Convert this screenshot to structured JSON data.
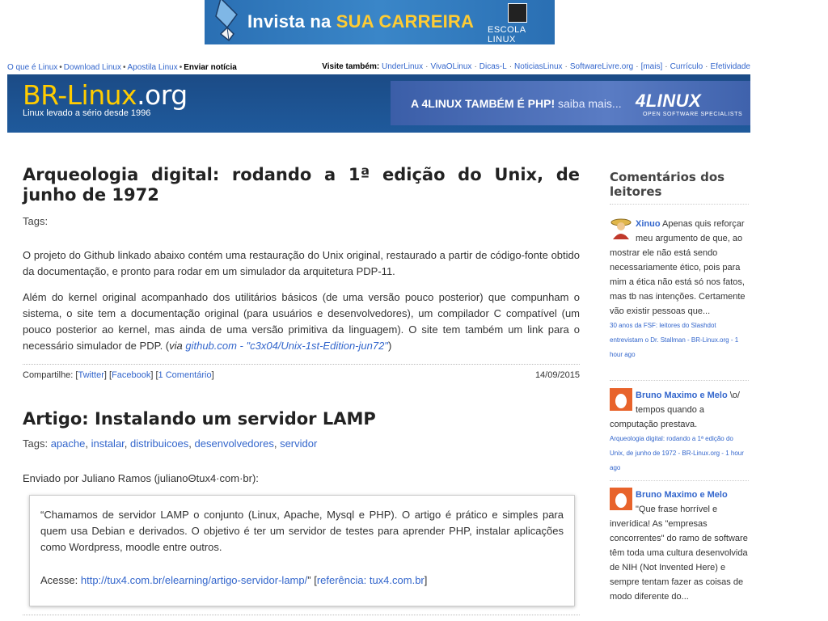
{
  "banner": {
    "text_main": "Invista na",
    "text_highlight": "SUA CARREIRA",
    "logo_label": "ESCOLA LINUX"
  },
  "nav": {
    "items": [
      {
        "label": "O que é Linux"
      },
      {
        "label": "Download Linux"
      },
      {
        "label": "Apostila Linux"
      },
      {
        "label": "Enviar notícia"
      }
    ],
    "visit_label": "Visite também:",
    "visit_links": [
      {
        "label": "UnderLinux"
      },
      {
        "label": "VivaOLinux"
      },
      {
        "label": "Dicas-L"
      },
      {
        "label": "NoticiasLinux"
      },
      {
        "label": "SoftwareLivre.org"
      },
      {
        "label": "[mais]"
      },
      {
        "label": "Currículo"
      },
      {
        "label": "Efetividade"
      }
    ]
  },
  "header": {
    "title_main": "BR-Linux",
    "title_suffix": ".org",
    "tagline": "Linux levado a sério desde 1996",
    "ad_text": "A 4LINUX TAMBÉM É PHP!",
    "ad_more": "saiba mais...",
    "ad_brand": "4LINUX",
    "ad_brand_sub": "OPEN SOFTWARE SPECIALISTS"
  },
  "post1": {
    "title": "Arqueologia digital: rodando a 1ª edição do Unix, de junho de 1972",
    "tags_label": "Tags:",
    "p1": "O projeto do Github linkado abaixo contém uma restauração do Unix original, restaurado a partir de código-fonte obtido da documentação, e pronto para rodar em um simulador da arquitetura PDP-11.",
    "p2": "Além do kernel original acompanhado dos utilitários básicos (de uma versão pouco posterior) que compunham o sistema, o site tem a documentação original (para usuários e desenvolvedores), um compilador C compatível (um pouco posterior ao kernel, mas ainda de uma versão primitiva da linguagem). O site tem também um link para o necessário simulador de PDP. (",
    "via_prefix": "via ",
    "via_link": "github.com - \"c3x04/Unix-1st-Edition-jun72\"",
    "p2_end": ")",
    "share_label": "Compartilhe:",
    "share_twitter": "Twitter",
    "share_facebook": "Facebook",
    "comments": "1 Comentário",
    "date": "14/09/2015"
  },
  "post2": {
    "title": "Artigo: Instalando um servidor LAMP",
    "tags_label": "Tags:",
    "tags": [
      "apache",
      "instalar",
      "distribuicoes",
      "desenvolvedores",
      "servidor"
    ],
    "sent_by": "Enviado por Juliano Ramos (julianoΘtux4·com·br):",
    "quote": "“Chamamos de servidor LAMP o conjunto (Linux, Apache, Mysql e PHP). O artigo é prático e simples para quem usa Debian e derivados. O objetivo é ter um servidor de testes para aprender PHP, instalar aplicações como Wordpress, moodle entre outros.",
    "access_label": "Acesse:",
    "access_link": "http://tux4.com.br/elearning/artigo-servidor-lamp/",
    "access_quote_end": "”",
    "ref_link": "referência: tux4.com.br"
  },
  "sidebar": {
    "title": "Comentários dos leitores",
    "comments": [
      {
        "author": "Xinuo",
        "text": " Apenas quis reforçar meu argumento de que, ao mostrar ele não está sendo necessariamente ético, pois para mim a ética não está só nos fatos, mas tb nas intenções. Certamente vão existir pessoas que...",
        "source": "30 anos da FSF: leitores do Slashdot entrevistam o Dr. Stallman - BR-Linux.org - 1 hour ago"
      },
      {
        "author": "Bruno Maximo e Melo",
        "text": " \\o/ tempos quando a computação prestava.",
        "source": "Arqueologia digital: rodando a 1ª edição do Unix, de junho de 1972 - BR-Linux.org - 1 hour ago"
      },
      {
        "author": "Bruno Maximo e Melo",
        "text": " \"Que frase horrível e inverídica! As \"empresas concorrentes\" do ramo de software têm toda uma cultura desenvolvida de NIH (Not Invented Here) e sempre tentam fazer as coisas de modo diferente do...",
        "source": ""
      }
    ]
  },
  "colors": {
    "header_bg": "#1f5a9c",
    "title_yellow": "#ffcc00",
    "link": "#3366cc",
    "avatar_orange": "#e8632b"
  },
  "icons": {
    "banner_pen": "fountain-pen-icon",
    "avatar1": "person-hat-avatar-icon",
    "avatar2": "egg-avatar-icon"
  }
}
